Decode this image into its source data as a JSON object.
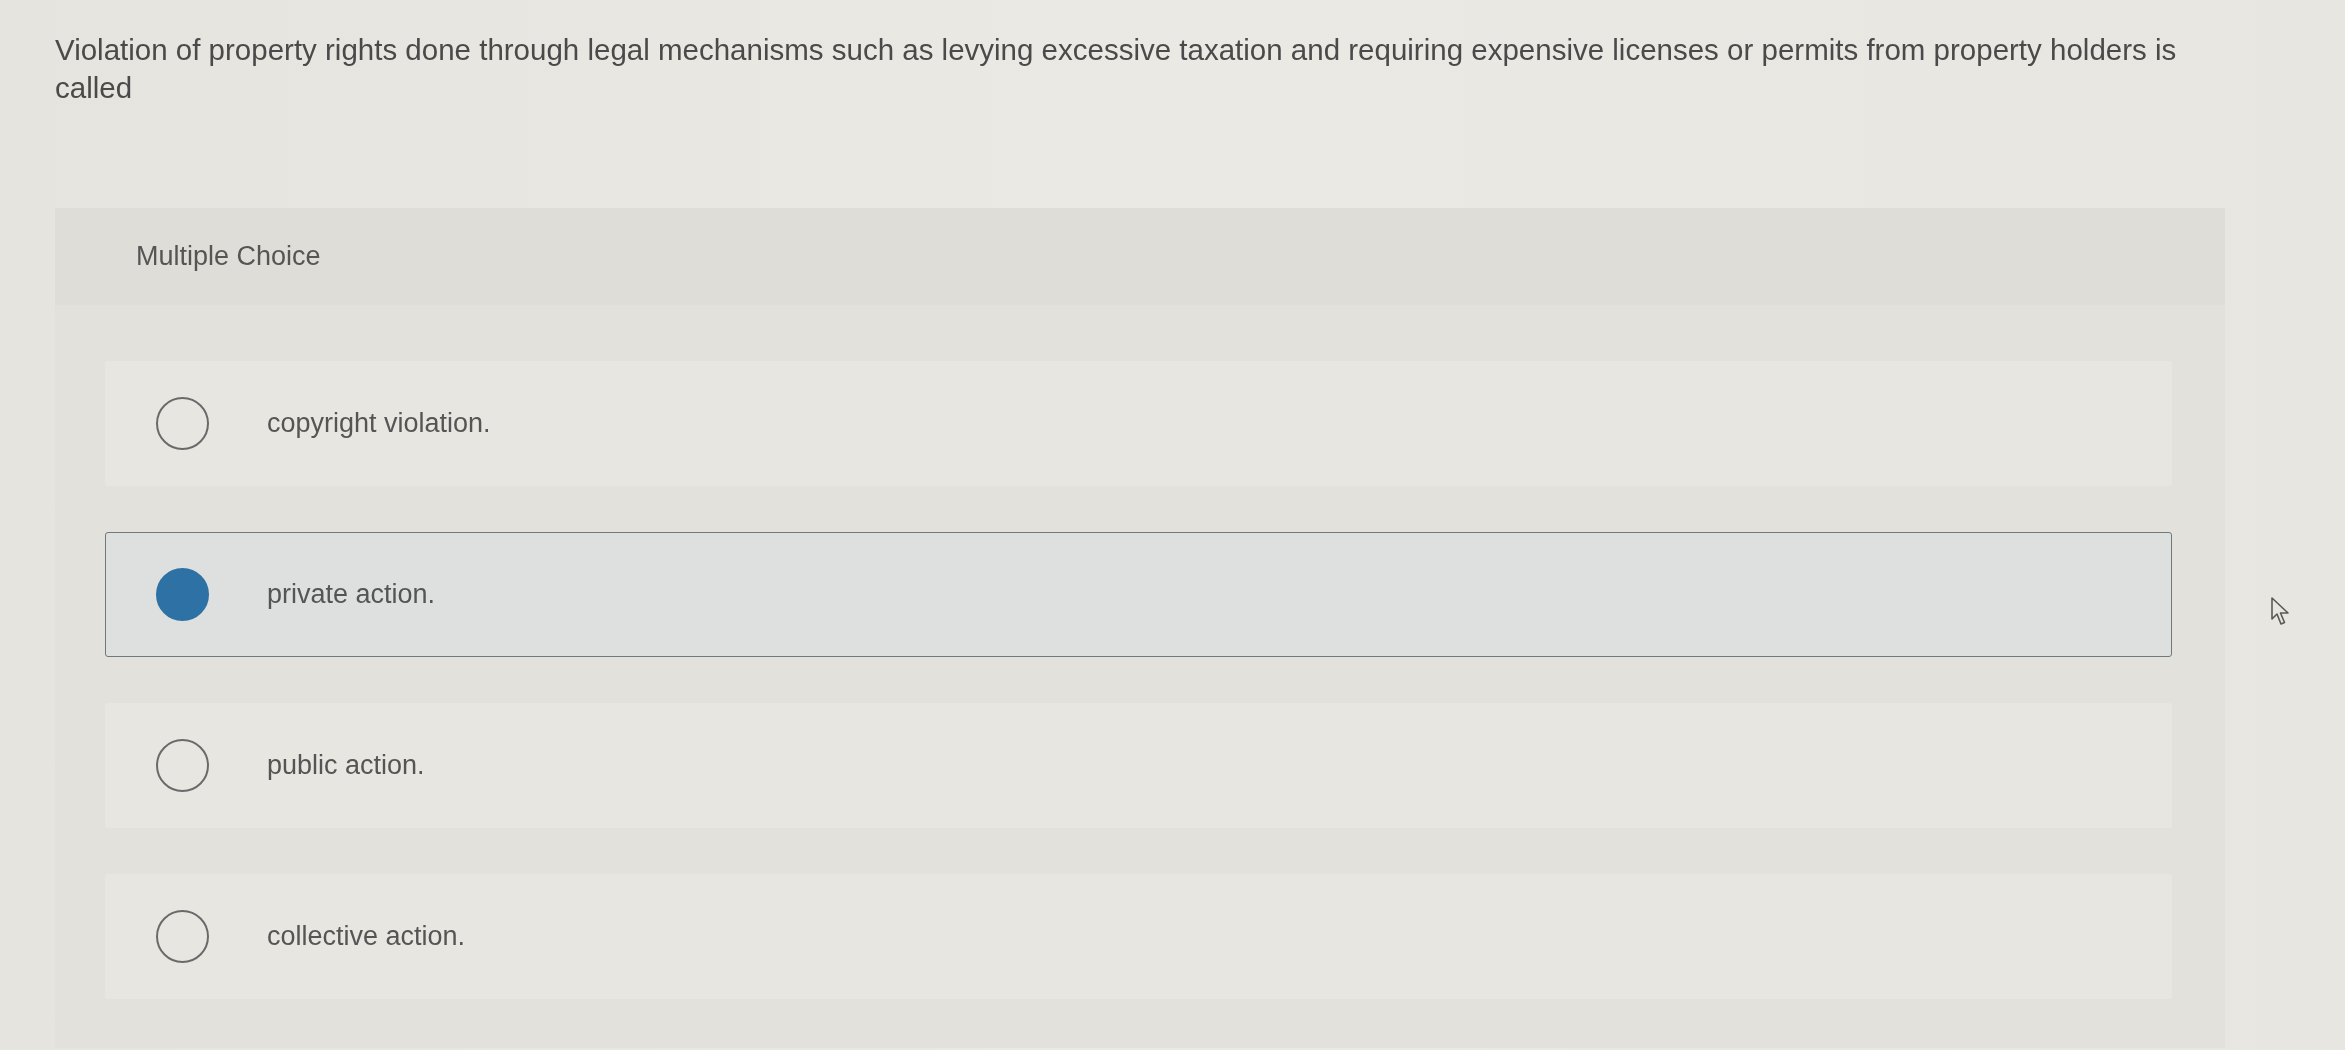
{
  "question": {
    "text": "Violation of property rights done through legal mechanisms such as levying excessive taxation and requiring expensive licenses or permits from property holders is called"
  },
  "multiple_choice": {
    "heading": "Multiple Choice",
    "options": [
      {
        "label": "copyright violation.",
        "selected": false
      },
      {
        "label": "private action.",
        "selected": true
      },
      {
        "label": "public action.",
        "selected": false
      },
      {
        "label": "collective action.",
        "selected": false
      }
    ]
  }
}
